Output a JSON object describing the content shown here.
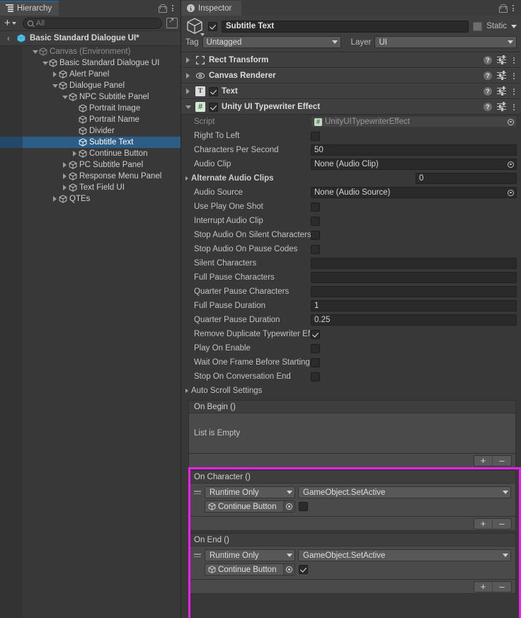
{
  "hierarchy": {
    "tab_label": "Hierarchy",
    "toolbar": {
      "add_label": "+",
      "search_placeholder": "All",
      "search_value": ""
    },
    "breadcrumb": {
      "back": "‹",
      "label": "Basic Standard Dialogue UI*"
    },
    "tree": [
      {
        "label": "Canvas (Environment)",
        "depth": 1,
        "twisty": "down",
        "dim": true,
        "selected": false
      },
      {
        "label": "Basic Standard Dialogue UI",
        "depth": 2,
        "twisty": "down",
        "dim": false,
        "selected": false
      },
      {
        "label": "Alert Panel",
        "depth": 3,
        "twisty": "right",
        "dim": false,
        "selected": false
      },
      {
        "label": "Dialogue Panel",
        "depth": 3,
        "twisty": "down",
        "dim": false,
        "selected": false
      },
      {
        "label": "NPC Subtitle Panel",
        "depth": 4,
        "twisty": "down",
        "dim": false,
        "selected": false
      },
      {
        "label": "Portrait Image",
        "depth": 5,
        "twisty": "none",
        "dim": false,
        "selected": false
      },
      {
        "label": "Portrait Name",
        "depth": 5,
        "twisty": "none",
        "dim": false,
        "selected": false
      },
      {
        "label": "Divider",
        "depth": 5,
        "twisty": "none",
        "dim": false,
        "selected": false
      },
      {
        "label": "Subtitle Text",
        "depth": 5,
        "twisty": "none",
        "dim": false,
        "selected": true
      },
      {
        "label": "Continue Button",
        "depth": 5,
        "twisty": "right",
        "dim": false,
        "selected": false
      },
      {
        "label": "PC Subtitle Panel",
        "depth": 4,
        "twisty": "right",
        "dim": false,
        "selected": false
      },
      {
        "label": "Response Menu Panel",
        "depth": 4,
        "twisty": "right",
        "dim": false,
        "selected": false
      },
      {
        "label": "Text Field UI",
        "depth": 4,
        "twisty": "right",
        "dim": false,
        "selected": false
      },
      {
        "label": "QTEs",
        "depth": 3,
        "twisty": "right",
        "dim": false,
        "selected": false
      }
    ]
  },
  "inspector": {
    "tab_label": "Inspector",
    "object": {
      "enabled": true,
      "name": "Subtitle Text",
      "static_label": "Static",
      "static_checked": false,
      "tag_label": "Tag",
      "tag_value": "Untagged",
      "layer_label": "Layer",
      "layer_value": "UI"
    },
    "components": [
      {
        "title": "Rect Transform",
        "icon": "rect-transform-icon",
        "expanded": false,
        "has_enable_checkbox": false
      },
      {
        "title": "Canvas Renderer",
        "icon": "canvas-renderer-icon",
        "expanded": false,
        "has_enable_checkbox": false
      },
      {
        "title": "Text",
        "icon": "text-component-icon",
        "expanded": false,
        "has_enable_checkbox": true,
        "enabled": true
      },
      {
        "title": "Unity UI Typewriter Effect",
        "icon": "script-icon",
        "expanded": true,
        "has_enable_checkbox": true,
        "enabled": true
      }
    ],
    "properties": [
      {
        "label": "Script",
        "type": "object-disabled",
        "value": "UnityUITypewriterEffect",
        "disabled": true
      },
      {
        "label": "Right To Left",
        "type": "checkbox",
        "checked": false
      },
      {
        "label": "Characters Per Second",
        "type": "text",
        "value": "50"
      },
      {
        "label": "Audio Clip",
        "type": "object",
        "value": "None (Audio Clip)"
      },
      {
        "label": "Alternate Audio Clips",
        "type": "array-foldout",
        "value": "0"
      },
      {
        "label": "Audio Source",
        "type": "object",
        "value": "None (Audio Source)"
      },
      {
        "label": "Use Play One Shot",
        "type": "checkbox",
        "checked": false
      },
      {
        "label": "Interrupt Audio Clip",
        "type": "checkbox",
        "checked": false
      },
      {
        "label": "Stop Audio On Silent Characters",
        "type": "checkbox",
        "checked": false
      },
      {
        "label": "Stop Audio On Pause Codes",
        "type": "checkbox",
        "checked": false
      },
      {
        "label": "Silent Characters",
        "type": "text",
        "value": ""
      },
      {
        "label": "Full Pause Characters",
        "type": "text",
        "value": ""
      },
      {
        "label": "Quarter Pause Characters",
        "type": "text",
        "value": ""
      },
      {
        "label": "Full Pause Duration",
        "type": "text",
        "value": "1"
      },
      {
        "label": "Quarter Pause Duration",
        "type": "text",
        "value": "0.25"
      },
      {
        "label": "Remove Duplicate Typewriter Ef",
        "type": "checkbox",
        "checked": true
      },
      {
        "label": "Play On Enable",
        "type": "checkbox",
        "checked": false
      },
      {
        "label": "Wait One Frame Before Starting",
        "type": "checkbox",
        "checked": false
      },
      {
        "label": "Stop On Conversation End",
        "type": "checkbox",
        "checked": false
      },
      {
        "label": "Auto Scroll Settings",
        "type": "foldout"
      }
    ],
    "events": [
      {
        "title": "On Begin ()",
        "empty_text": "List is Empty",
        "entries": [],
        "add_label": "+",
        "remove_label": "–"
      },
      {
        "title": "On Character ()",
        "entries": [
          {
            "mode": "Runtime Only",
            "function": "GameObject.SetActive",
            "target": "Continue Button",
            "arg_checked": false
          }
        ],
        "add_label": "+",
        "remove_label": "–"
      },
      {
        "title": "On End ()",
        "entries": [
          {
            "mode": "Runtime Only",
            "function": "GameObject.SetActive",
            "target": "Continue Button",
            "arg_checked": true
          }
        ],
        "add_label": "+",
        "remove_label": "–"
      }
    ]
  },
  "annotation": {
    "highlight_color": "#ee1fee"
  }
}
